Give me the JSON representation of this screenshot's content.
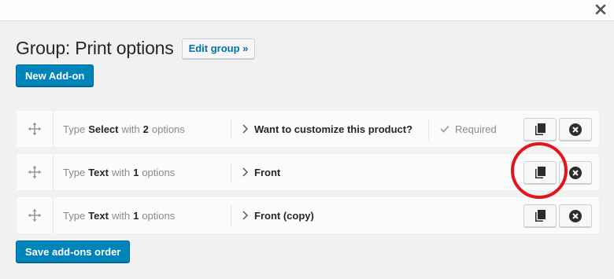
{
  "modal": {
    "close_icon": "close-icon"
  },
  "header": {
    "title": "Group: Print options",
    "edit_group_label": "Edit group »"
  },
  "buttons": {
    "new_addon_label": "New Add-on",
    "save_order_label": "Save add-ons order"
  },
  "addons": [
    {
      "type_prefix": "Type",
      "type": "Select",
      "with": "with",
      "count": "2",
      "options_word": "options",
      "title": "Want to customize this product?",
      "required_label": "Required"
    },
    {
      "type_prefix": "Type",
      "type": "Text",
      "with": "with",
      "count": "1",
      "options_word": "options",
      "title": "Front"
    },
    {
      "type_prefix": "Type",
      "type": "Text",
      "with": "with",
      "count": "1",
      "options_word": "options",
      "title": "Front (copy)"
    }
  ],
  "colors": {
    "primary_button": "#0085ba",
    "link": "#0073aa",
    "highlight_ring": "#e8121b"
  }
}
